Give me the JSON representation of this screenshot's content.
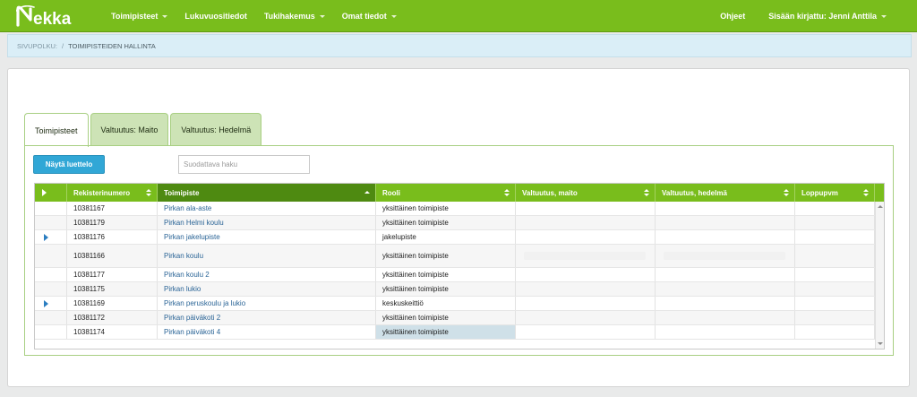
{
  "app": {
    "logo_text": "Nekka",
    "nav": [
      {
        "label": "Toimipisteet",
        "dropdown": true
      },
      {
        "label": "Lukuvuositiedot",
        "dropdown": false
      },
      {
        "label": "Tukihakemus",
        "dropdown": true
      },
      {
        "label": "Omat tiedot",
        "dropdown": true
      }
    ],
    "help_label": "Ohjeet",
    "user_label": "Sisään kirjattu: Jenni Anttila",
    "brand_color": "#79bd1c"
  },
  "breadcrumb": {
    "root": "SIVUPOLKU:",
    "separator": "/",
    "current": "TOIMIPISTEIDEN HALLINTA"
  },
  "tabs": [
    {
      "label": "Toimipisteet",
      "active": true
    },
    {
      "label": "Valtuutus: Maito",
      "active": false
    },
    {
      "label": "Valtuutus: Hedelmä",
      "active": false
    }
  ],
  "toolbar": {
    "list_button": "Näytä luettelo",
    "search_placeholder": "Suodattava haku",
    "search_value": ""
  },
  "grid": {
    "columns": [
      "Rekisterinumero",
      "Toimipiste",
      "Rooli",
      "Valtuutus, maito",
      "Valtuutus, hedelmä",
      "Loppupvm"
    ],
    "sorted_column": "Toimipiste",
    "rows": [
      {
        "expandable": false,
        "reg": "10381167",
        "name": "Pirkan ala-aste",
        "role": "yksittäinen toimipiste",
        "maito": "",
        "hedelma": "",
        "loppupvm": ""
      },
      {
        "expandable": false,
        "reg": "10381179",
        "name": "Pirkan Helmi koulu",
        "role": "yksittäinen toimipiste",
        "maito": "",
        "hedelma": "",
        "loppupvm": ""
      },
      {
        "expandable": true,
        "reg": "10381176",
        "name": "Pirkan jakelupiste",
        "role": "jakelupiste",
        "maito": "",
        "hedelma": "",
        "loppupvm": ""
      },
      {
        "expandable": false,
        "reg": "10381166",
        "name": "Pirkan koulu",
        "role": "yksittäinen toimipiste",
        "maito": "",
        "hedelma": "",
        "loppupvm": "",
        "blurred": true
      },
      {
        "expandable": false,
        "reg": "10381177",
        "name": "Pirkan koulu 2",
        "role": "yksittäinen toimipiste",
        "maito": "",
        "hedelma": "",
        "loppupvm": ""
      },
      {
        "expandable": false,
        "reg": "10381175",
        "name": "Pirkan lukio",
        "role": "yksittäinen toimipiste",
        "maito": "",
        "hedelma": "",
        "loppupvm": ""
      },
      {
        "expandable": true,
        "reg": "10381169",
        "name": "Pirkan peruskoulu ja lukio",
        "role": "keskuskeittiö",
        "maito": "",
        "hedelma": "",
        "loppupvm": ""
      },
      {
        "expandable": false,
        "reg": "10381172",
        "name": "Pirkan päiväkoti 2",
        "role": "yksittäinen toimipiste",
        "maito": "",
        "hedelma": "",
        "loppupvm": ""
      },
      {
        "expandable": false,
        "reg": "10381174",
        "name": "Pirkan päiväkoti 4",
        "role": "yksittäinen toimipiste",
        "maito": "",
        "hedelma": "",
        "loppupvm": "",
        "selected_role": true
      }
    ]
  }
}
